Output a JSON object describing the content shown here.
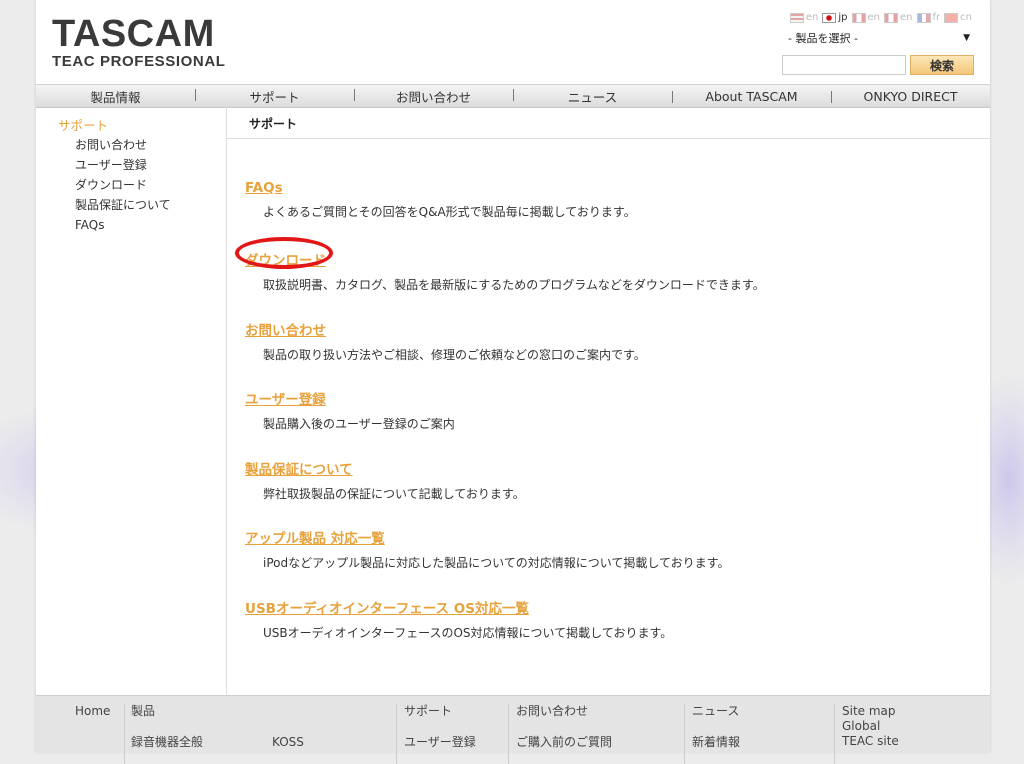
{
  "header": {
    "logo_main": "TASCAM",
    "logo_sub": "TEAC PROFESSIONAL",
    "languages": [
      {
        "code": "en",
        "flag": "us",
        "active": false
      },
      {
        "code": "jp",
        "flag": "jp",
        "active": true
      },
      {
        "code": "en",
        "flag": "ca",
        "active": false
      },
      {
        "code": "en",
        "flag": "ca",
        "active": false
      },
      {
        "code": "fr",
        "flag": "fr",
        "active": false
      },
      {
        "code": "cn",
        "flag": "cn",
        "active": false
      }
    ],
    "product_select_value": "- 製品を選択 -",
    "search_button_label": "検索",
    "search_value": ""
  },
  "nav": {
    "items": [
      "製品情報",
      "サポート",
      "お問い合わせ",
      "ニュース",
      "About TASCAM",
      "ONKYO DIRECT"
    ]
  },
  "sidebar": {
    "heading": "サポート",
    "items": [
      "お問い合わせ",
      "ユーザー登録",
      "ダウンロード",
      "製品保証について",
      "FAQs"
    ]
  },
  "main": {
    "breadcrumb": "サポート",
    "entries": [
      {
        "title": "FAQs",
        "desc": "よくあるご質問とその回答をQ&A形式で製品毎に掲載しております。"
      },
      {
        "title": "ダウンロード",
        "desc": "取扱説明書、カタログ、製品を最新版にするためのプログラムなどをダウンロードできます。"
      },
      {
        "title": "お問い合わせ",
        "desc": "製品の取り扱い方法やご相談、修理のご依頼などの窓口のご案内です。"
      },
      {
        "title": "ユーザー登録",
        "desc": "製品購入後のユーザー登録のご案内"
      },
      {
        "title": "製品保証について",
        "desc": "弊社取扱製品の保証について記載しております。"
      },
      {
        "title": "アップル製品 対応一覧",
        "desc": "iPodなどアップル製品に対応した製品についての対応情報について掲載しております。"
      },
      {
        "title": "USBオーディオインターフェース OS対応一覧",
        "desc": "USBオーディオインターフェースのOS対応情報について掲載しております。"
      }
    ]
  },
  "footer": {
    "home": "Home",
    "products": "製品",
    "products_all": "録音機器全般",
    "koss": "KOSS",
    "support": "サポート",
    "user_reg": "ユーザー登録",
    "contact": "お問い合わせ",
    "before_purchase": "ご購入前のご質問",
    "news": "ニュース",
    "new_info": "新着情報",
    "sitemap": "Site map",
    "global": "Global",
    "teac_site": "TEAC site"
  },
  "colors": {
    "accent": "#e8a23c",
    "highlight_circle": "#e31616"
  }
}
